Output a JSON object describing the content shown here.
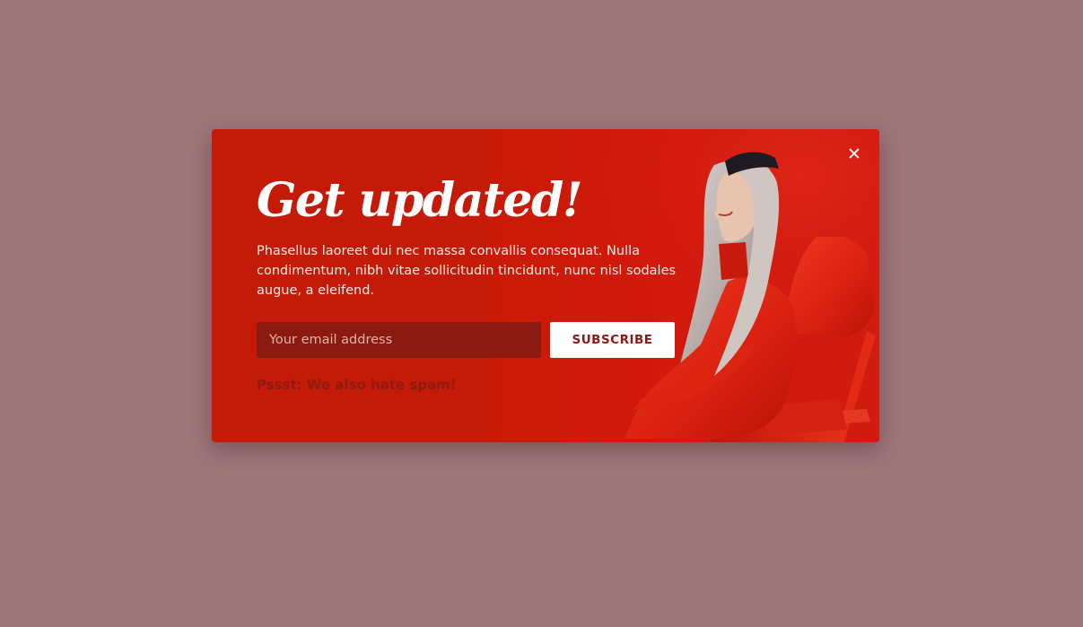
{
  "page": {
    "background_color": "#9e7579"
  },
  "popup": {
    "background_color": "#c41b08",
    "title": "Get updated!",
    "description": "Phasellus laoreet dui nec massa convallis consequat. Nulla condimentum, nibh vitae sollicitudin tincidunt, nunc nisl sodales augue, a eleifend.",
    "email_placeholder": "Your email address",
    "email_value": "",
    "subscribe_label": "SUBSCRIBE",
    "footnote": "Pssst: We also hate spam!",
    "close_icon": "close-icon",
    "close_glyph": "✕",
    "image": "woman-in-red-suit-photo"
  }
}
